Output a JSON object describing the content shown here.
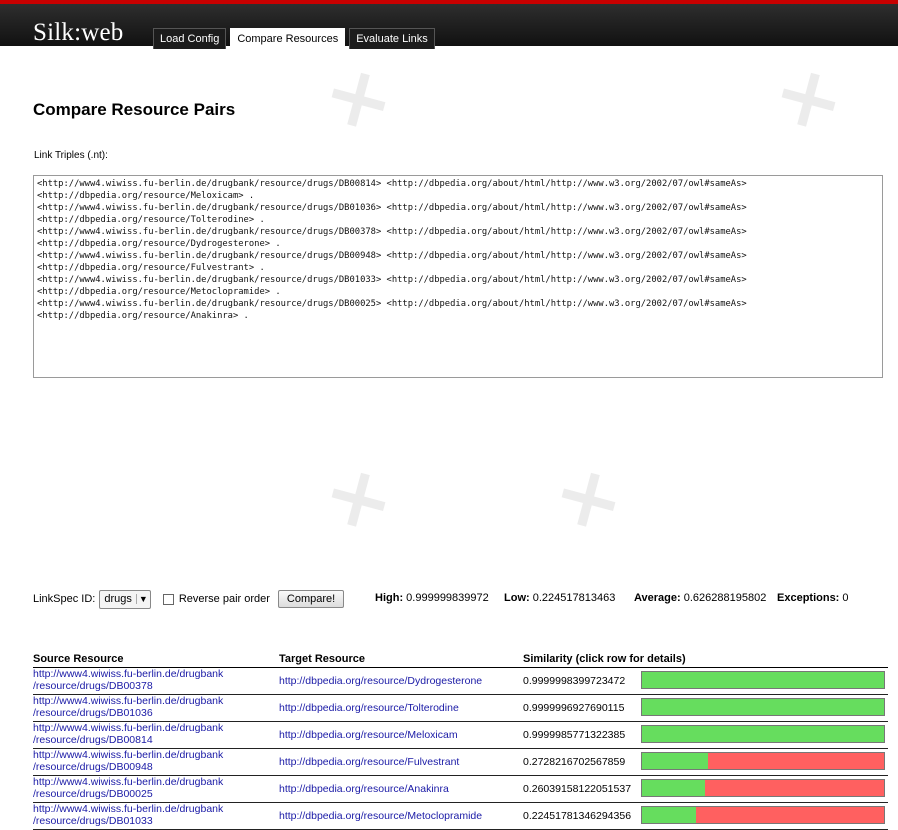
{
  "app": {
    "logo": "Silk:web"
  },
  "tabs": [
    {
      "label": "Load Config",
      "active": false
    },
    {
      "label": "Compare Resources",
      "active": true
    },
    {
      "label": "Evaluate Links",
      "active": false
    }
  ],
  "page_title": "Compare Resource Pairs",
  "triples": {
    "label": "Link Triples (.nt):",
    "text": "<http://www4.wiwiss.fu-berlin.de/drugbank/resource/drugs/DB00814> <http://dbpedia.org/about/html/http://www.w3.org/2002/07/owl#sameAs>\n<http://dbpedia.org/resource/Meloxicam> .\n<http://www4.wiwiss.fu-berlin.de/drugbank/resource/drugs/DB01036> <http://dbpedia.org/about/html/http://www.w3.org/2002/07/owl#sameAs>\n<http://dbpedia.org/resource/Tolterodine> .\n<http://www4.wiwiss.fu-berlin.de/drugbank/resource/drugs/DB00378> <http://dbpedia.org/about/html/http://www.w3.org/2002/07/owl#sameAs>\n<http://dbpedia.org/resource/Dydrogesterone> .\n<http://www4.wiwiss.fu-berlin.de/drugbank/resource/drugs/DB00948> <http://dbpedia.org/about/html/http://www.w3.org/2002/07/owl#sameAs>\n<http://dbpedia.org/resource/Fulvestrant> .\n<http://www4.wiwiss.fu-berlin.de/drugbank/resource/drugs/DB01033> <http://dbpedia.org/about/html/http://www.w3.org/2002/07/owl#sameAs>\n<http://dbpedia.org/resource/Metoclopramide> .\n<http://www4.wiwiss.fu-berlin.de/drugbank/resource/drugs/DB00025> <http://dbpedia.org/about/html/http://www.w3.org/2002/07/owl#sameAs>\n<http://dbpedia.org/resource/Anakinra> ."
  },
  "controls": {
    "linkspec_label": "LinkSpec ID:",
    "linkspec_value": "drugs",
    "reverse_label": "Reverse pair order",
    "reverse_checked": false,
    "compare_label": "Compare!"
  },
  "stats": {
    "high_label": "High:",
    "high_value": "0.999999839972",
    "low_label": "Low:",
    "low_value": "0.224517813463",
    "avg_label": "Average:",
    "avg_value": "0.626288195802",
    "exc_label": "Exceptions:",
    "exc_value": "0"
  },
  "results": {
    "headers": {
      "source": "Source Resource",
      "target": "Target Resource",
      "similarity": "Similarity (click row for details)"
    },
    "rows": [
      {
        "source_line1": "http://www4.wiwiss.fu-berlin.de/drugbank",
        "source_line2": "/resource/drugs/DB00378",
        "target": "http://dbpedia.org/resource/Dydrogesterone",
        "similarity": "0.9999998399723472",
        "score": 0.9999998399723472
      },
      {
        "source_line1": "http://www4.wiwiss.fu-berlin.de/drugbank",
        "source_line2": "/resource/drugs/DB01036",
        "target": "http://dbpedia.org/resource/Tolterodine",
        "similarity": "0.9999996927690115",
        "score": 0.9999996927690115
      },
      {
        "source_line1": "http://www4.wiwiss.fu-berlin.de/drugbank",
        "source_line2": "/resource/drugs/DB00814",
        "target": "http://dbpedia.org/resource/Meloxicam",
        "similarity": "0.9999985771322385",
        "score": 0.9999985771322385
      },
      {
        "source_line1": "http://www4.wiwiss.fu-berlin.de/drugbank",
        "source_line2": "/resource/drugs/DB00948",
        "target": "http://dbpedia.org/resource/Fulvestrant",
        "similarity": "0.2728216702567859",
        "score": 0.2728216702567859
      },
      {
        "source_line1": "http://www4.wiwiss.fu-berlin.de/drugbank",
        "source_line2": "/resource/drugs/DB00025",
        "target": "http://dbpedia.org/resource/Anakinra",
        "similarity": "0.26039158122051537",
        "score": 0.26039158122051537
      },
      {
        "source_line1": "http://www4.wiwiss.fu-berlin.de/drugbank",
        "source_line2": "/resource/drugs/DB01033",
        "target": "http://dbpedia.org/resource/Metoclopramide",
        "similarity": "0.22451781346294356",
        "score": 0.22451781346294356
      }
    ]
  },
  "colors": {
    "bar_match": "#66dd5e",
    "bar_mismatch": "#ff6060",
    "header_bg": "#1a1a1a",
    "accent_strip": "#c80000"
  }
}
